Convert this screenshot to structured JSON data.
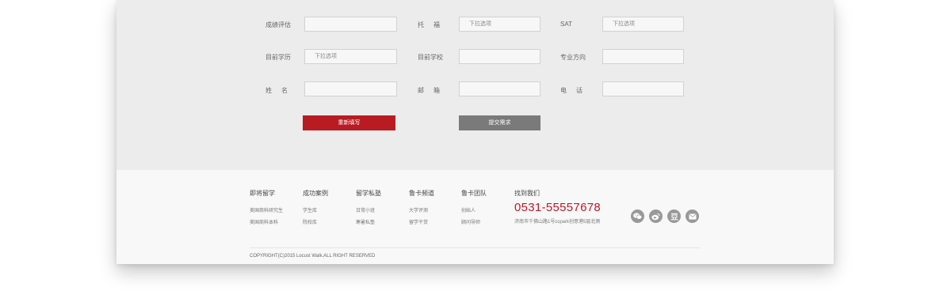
{
  "form": {
    "row1": {
      "label_score": "成绩评估",
      "label_toefl": "托福",
      "toefl_value": "下拉选项",
      "label_sat": "SAT",
      "sat_value": "下拉选项"
    },
    "row2": {
      "label_education": "目前学历",
      "education_value": "下拉选项",
      "label_school": "目前学校",
      "label_major": "专业方向"
    },
    "row3": {
      "label_name": "姓名",
      "label_email": "邮箱",
      "label_phone": "电话"
    },
    "reset_button": "重新填写",
    "submit_button": "提交需求"
  },
  "footer": {
    "columns": [
      {
        "title": "即将留学",
        "links": [
          "美国商科研究生",
          "美国商科本科"
        ]
      },
      {
        "title": "成功案例",
        "links": [
          "学生库",
          "院校库"
        ]
      },
      {
        "title": "留学私塾",
        "links": [
          "日常小班",
          "寒暑私塾"
        ]
      },
      {
        "title": "鲁卡频道",
        "links": [
          "大学评测",
          "留学干货"
        ]
      },
      {
        "title": "鲁卡团队",
        "links": [
          "创始人",
          "顾问导师"
        ]
      }
    ],
    "contact": {
      "title": "找到我们",
      "phone": "0531-55557678",
      "address": "济南市千佛山路1号ccpark创意港5层北侧"
    },
    "social_icons": [
      "wechat-icon",
      "weibo-icon",
      "douban-icon",
      "email-icon"
    ],
    "copyright": "COPYRIGHT(C)2015 Locust Walk.ALL RIGHT RESERVED"
  },
  "colors": {
    "accent_red": "#b81c22",
    "phone_red": "#c0182a",
    "button_gray": "#7a7a7a"
  }
}
